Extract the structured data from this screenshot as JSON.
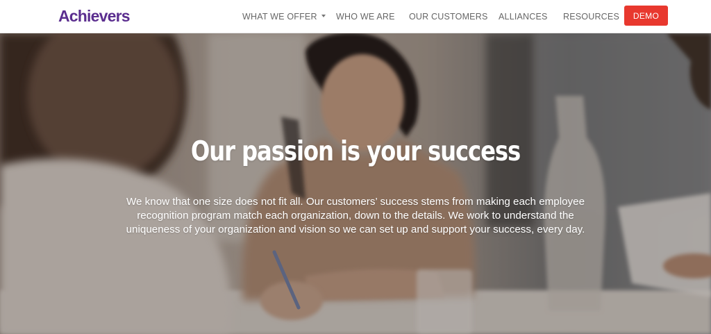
{
  "header": {
    "logo_text": "Achievers",
    "nav": [
      {
        "label": "WHAT WE OFFER",
        "has_dropdown": true
      },
      {
        "label": "WHO WE ARE"
      },
      {
        "label": "OUR CUSTOMERS"
      },
      {
        "label": "ALLIANCES"
      },
      {
        "label": "RESOURCES"
      }
    ],
    "demo_label": "DEMO"
  },
  "hero": {
    "title": "Our passion is your success",
    "body": "We know that one size does not fit all. Our customers’ success stems from making each employee recognition program match each organization, down to the details. We work to understand the uniqueness of your organization and vision so we can set up and support your success, every day."
  },
  "colors": {
    "brand_purple": "#5b2e8f",
    "demo_red": "#e8382e",
    "nav_text": "#666666"
  },
  "icons": {
    "dropdown": "caret-down-icon"
  }
}
